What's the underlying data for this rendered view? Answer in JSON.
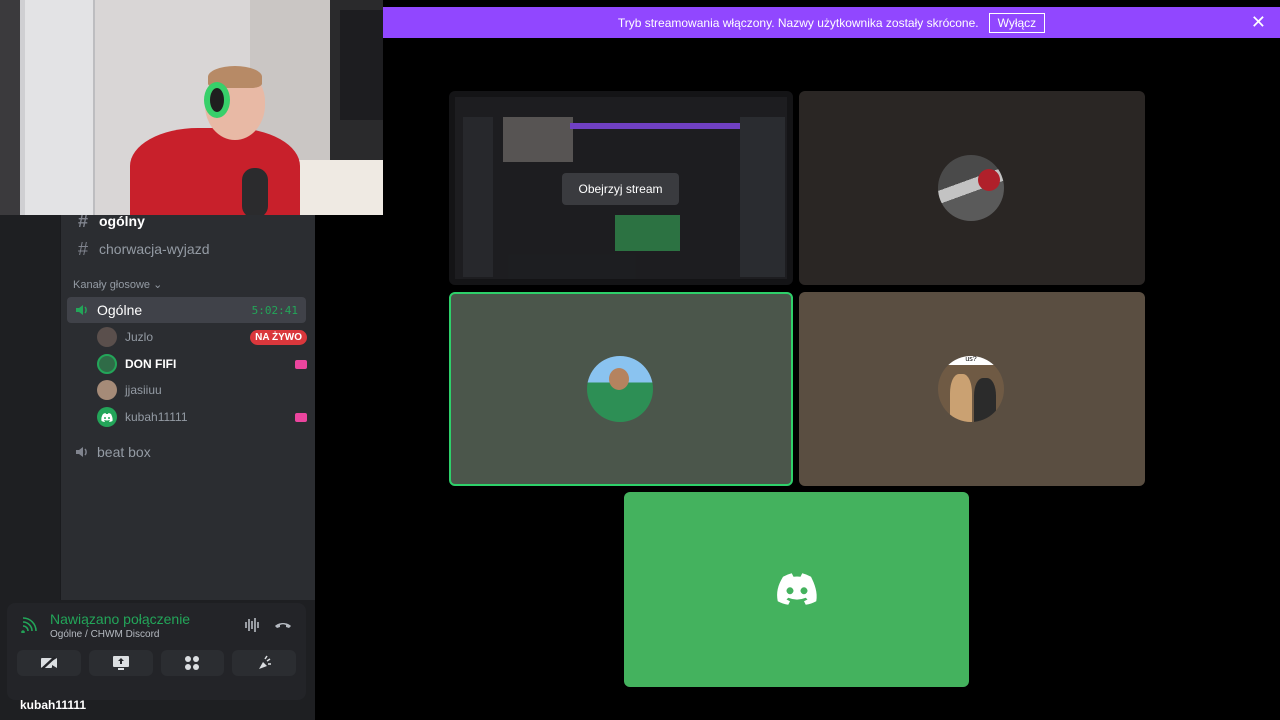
{
  "banner": {
    "text": "Tryb streamowania włączony. Nazwy użytkownika zostały skrócone.",
    "button": "Wyłącz"
  },
  "channels": {
    "text": [
      {
        "name": "ogólny",
        "active": true
      },
      {
        "name": "chorwacja-wyjazd",
        "active": false
      }
    ],
    "voice_category": "Kanały głosowe",
    "voice_channel": {
      "name": "Ogólne",
      "time": "5:02:41"
    },
    "members": [
      {
        "name": "Juzlo",
        "badge": "NA ŻYWO"
      },
      {
        "name": "DON FIFI",
        "streaming": true
      },
      {
        "name": "jjasiiuu"
      },
      {
        "name": "kubah11111",
        "streaming": true
      }
    ],
    "other_voice": "beat box"
  },
  "connection": {
    "status": "Nawiązano połączenie",
    "location": "Ogólne / CHWM Discord"
  },
  "user_peek": "kubah11111",
  "grid": {
    "watch_button": "Obejrzyj stream",
    "avatar_caption": "us?"
  },
  "colors": {
    "accent_banner": "#9147ff",
    "connected_green": "#23a559",
    "live_red": "#da373c",
    "speaking_border": "#2ed06a",
    "discord_tile": "#44b25e"
  }
}
